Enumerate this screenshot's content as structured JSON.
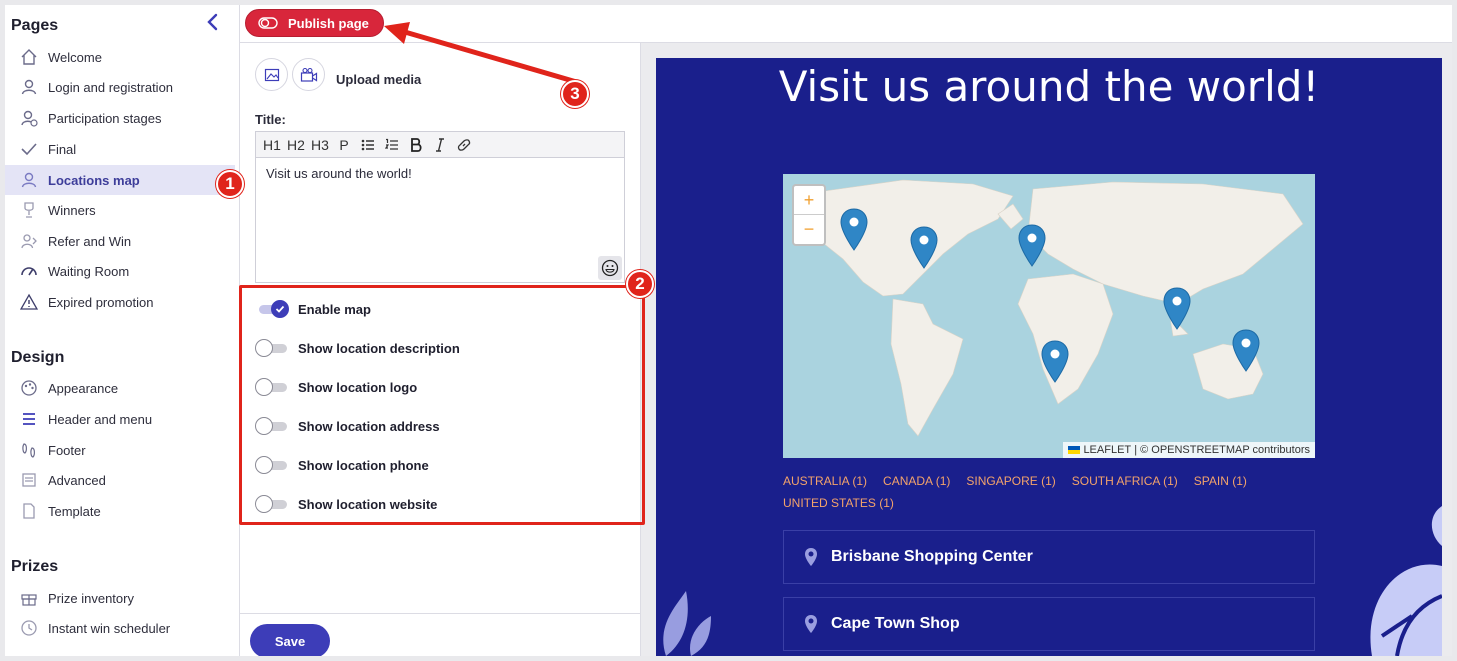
{
  "sidebar": {
    "sections": [
      {
        "title": "Pages"
      },
      {
        "title": "Design"
      },
      {
        "title": "Prizes"
      }
    ],
    "pages": [
      {
        "label": "Welcome",
        "icon": "home-icon"
      },
      {
        "label": "Login and registration",
        "icon": "user-icon"
      },
      {
        "label": "Participation stages",
        "icon": "user-plus-icon"
      },
      {
        "label": "Final",
        "icon": "check-icon"
      },
      {
        "label": "Locations map",
        "icon": "location-icon",
        "active": true
      },
      {
        "label": "Winners",
        "icon": "trophy-icon"
      },
      {
        "label": "Refer and Win",
        "icon": "refer-icon"
      },
      {
        "label": "Waiting Room",
        "icon": "gauge-icon"
      },
      {
        "label": "Expired promotion",
        "icon": "warning-icon"
      }
    ],
    "design": [
      {
        "label": "Appearance",
        "icon": "palette-icon"
      },
      {
        "label": "Header and menu",
        "icon": "menu-icon"
      },
      {
        "label": "Footer",
        "icon": "footprint-icon"
      },
      {
        "label": "Advanced",
        "icon": "advanced-icon"
      },
      {
        "label": "Template",
        "icon": "document-icon"
      }
    ],
    "prizes": [
      {
        "label": "Prize inventory",
        "icon": "gift-icon"
      },
      {
        "label": "Instant win scheduler",
        "icon": "clock-icon"
      }
    ]
  },
  "topbar": {
    "publish_label": "Publish page"
  },
  "editor": {
    "upload_label": "Upload media",
    "title_label": "Title:",
    "toolbar": [
      "H1",
      "H2",
      "H3",
      "P"
    ],
    "title_value": "Visit us around the world!",
    "options": [
      {
        "label": "Enable map",
        "on": true
      },
      {
        "label": "Show location description",
        "on": false
      },
      {
        "label": "Show location logo",
        "on": false
      },
      {
        "label": "Show location address",
        "on": false
      },
      {
        "label": "Show location phone",
        "on": false
      },
      {
        "label": "Show location website",
        "on": false
      }
    ],
    "save_label": "Save"
  },
  "preview": {
    "title": "Visit us around the world!",
    "map": {
      "zoom_in": "+",
      "zoom_out": "−",
      "attribution_leaflet": "LEAFLET",
      "attribution_rest": "| © OPENSTREETMAP contributors"
    },
    "countries": [
      "AUSTRALIA (1)",
      "CANADA (1)",
      "SINGAPORE (1)",
      "SOUTH AFRICA (1)",
      "SPAIN (1)",
      "UNITED STATES (1)"
    ],
    "locations": [
      {
        "name": "Brisbane Shopping Center"
      },
      {
        "name": "Cape Town Shop"
      }
    ]
  },
  "callouts": [
    "1",
    "2",
    "3"
  ],
  "colors": {
    "accent": "#3d3db8",
    "publish": "#d8263b",
    "preview_bg": "#1a1f8c",
    "callout": "#e0241b",
    "country_link": "#f3a36b",
    "map_marker": "#2f86c6"
  }
}
